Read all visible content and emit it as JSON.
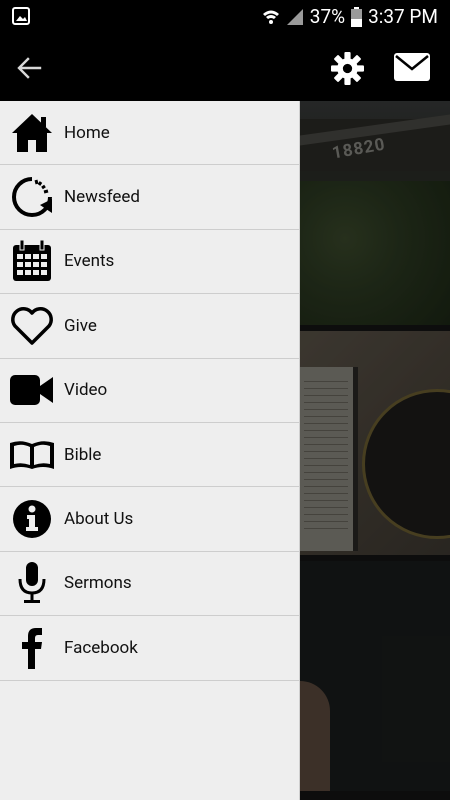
{
  "status_bar": {
    "battery": "37%",
    "time": "3:37 PM",
    "icons": [
      "gallery-icon",
      "wifi-icon",
      "signal-icon",
      "battery-icon"
    ]
  },
  "toolbar": {
    "icons": [
      "back-arrow-icon",
      "gear-icon",
      "mail-icon"
    ]
  },
  "menu": {
    "items": [
      {
        "label": "Home",
        "icon": "home-icon"
      },
      {
        "label": "Newsfeed",
        "icon": "refresh-icon"
      },
      {
        "label": "Events",
        "icon": "calendar-icon"
      },
      {
        "label": "Give",
        "icon": "heart-icon"
      },
      {
        "label": "Video",
        "icon": "video-camera-icon"
      },
      {
        "label": "Bible",
        "icon": "open-book-icon"
      },
      {
        "label": "About Us",
        "icon": "info-icon"
      },
      {
        "label": "Sermons",
        "icon": "microphone-icon"
      },
      {
        "label": "Facebook",
        "icon": "facebook-icon"
      }
    ]
  },
  "background": {
    "address_sign": "18820"
  },
  "colors": {
    "toolbar": "#000000",
    "drawer": "#eeeeee",
    "divider": "#cdcdcd",
    "text": "#111111"
  }
}
